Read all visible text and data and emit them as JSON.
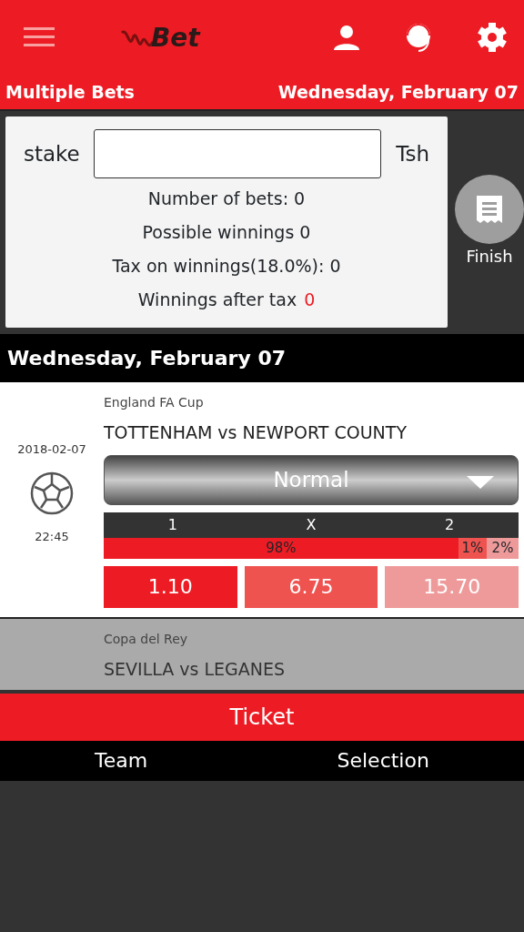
{
  "header": {
    "brand": "Bet"
  },
  "subbar": {
    "title": "Multiple Bets",
    "date": "Wednesday, February 07"
  },
  "slip": {
    "stake_label": "stake",
    "currency": "Tsh",
    "lines": [
      {
        "text": "Number of bets: 0"
      },
      {
        "text": "Possible winnings 0"
      },
      {
        "text": "Tax on winnings(18.0%): 0"
      }
    ],
    "after_tax_label": "Winnings after tax",
    "after_tax_value": "0",
    "finish": "Finish"
  },
  "day_header": "Wednesday, February 07",
  "matches": [
    {
      "disabled": false,
      "competition": "England FA Cup",
      "teams": "TOTTENHAM vs NEWPORT COUNTY",
      "date": "2018-02-07",
      "time": "22:45",
      "market": "Normal",
      "outcomes": [
        {
          "label": "1",
          "share": "98%",
          "odds": "1.10",
          "color": "#ed1c24"
        },
        {
          "label": "X",
          "share": "1%",
          "odds": "6.75",
          "color": "#ef5350"
        },
        {
          "label": "2",
          "share": "2%",
          "odds": "15.70",
          "color": "#ef9a9a"
        }
      ]
    },
    {
      "disabled": true,
      "competition": "Copa del Rey",
      "teams": "SEVILLA vs LEGANES"
    }
  ],
  "ticket": {
    "title": "Ticket",
    "columns": [
      "Team",
      "Selection"
    ]
  }
}
